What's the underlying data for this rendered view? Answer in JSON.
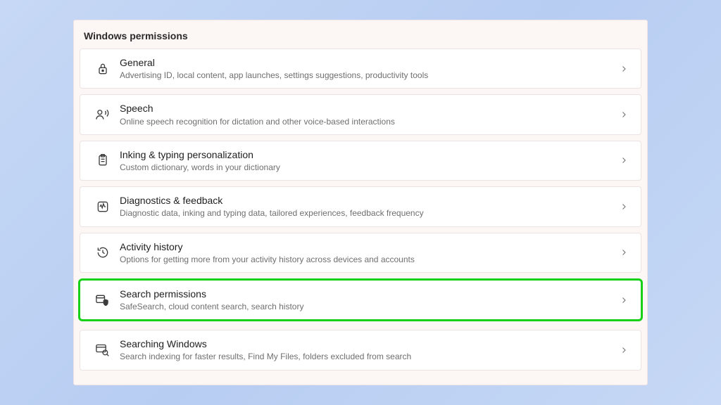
{
  "section_title": "Windows permissions",
  "rows": [
    {
      "title": "General",
      "desc": "Advertising ID, local content, app launches, settings suggestions, productivity tools"
    },
    {
      "title": "Speech",
      "desc": "Online speech recognition for dictation and other voice-based interactions"
    },
    {
      "title": "Inking & typing personalization",
      "desc": "Custom dictionary, words in your dictionary"
    },
    {
      "title": "Diagnostics & feedback",
      "desc": "Diagnostic data, inking and typing data, tailored experiences, feedback frequency"
    },
    {
      "title": "Activity history",
      "desc": "Options for getting more from your activity history across devices and accounts"
    },
    {
      "title": "Search permissions",
      "desc": "SafeSearch, cloud content search, search history"
    },
    {
      "title": "Searching Windows",
      "desc": "Search indexing for faster results, Find My Files, folders excluded from search"
    }
  ]
}
